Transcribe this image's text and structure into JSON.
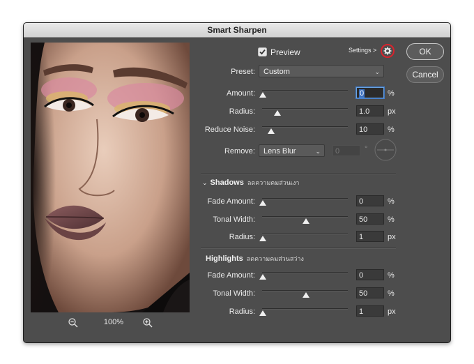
{
  "window": {
    "title": "Smart Sharpen"
  },
  "preview_toggle": {
    "label": "Preview",
    "checked": true
  },
  "settings": {
    "label": "Settings >"
  },
  "buttons": {
    "ok": "OK",
    "cancel": "Cancel"
  },
  "zoom": {
    "level": "100%"
  },
  "main": {
    "preset_label": "Preset:",
    "preset_value": "Custom",
    "amount": {
      "label": "Amount:",
      "value": "0",
      "unit": "%",
      "level": 0.0
    },
    "radius": {
      "label": "Radius:",
      "value": "1.0",
      "unit": "px",
      "level": 0.17
    },
    "reduce_noise": {
      "label": "Reduce Noise:",
      "value": "10",
      "unit": "%",
      "level": 0.1
    },
    "remove": {
      "label": "Remove:",
      "value": "Lens Blur",
      "angle_value": "0",
      "angle_unit": "°"
    }
  },
  "shadows": {
    "heading": "Shadows",
    "subtitle": "ลดความคมส่วนเงา",
    "fade_amount": {
      "label": "Fade Amount:",
      "value": "0",
      "unit": "%",
      "level": 0.0
    },
    "tonal_width": {
      "label": "Tonal Width:",
      "value": "50",
      "unit": "%",
      "level": 0.5
    },
    "radius": {
      "label": "Radius:",
      "value": "1",
      "unit": "px",
      "level": 0.0
    }
  },
  "highlights": {
    "heading": "Highlights",
    "subtitle": "ลดความคมส่วนสว่าง",
    "fade_amount": {
      "label": "Fade Amount:",
      "value": "0",
      "unit": "%",
      "level": 0.0
    },
    "tonal_width": {
      "label": "Tonal Width:",
      "value": "50",
      "unit": "%",
      "level": 0.5
    },
    "radius": {
      "label": "Radius:",
      "value": "1",
      "unit": "px",
      "level": 0.0
    }
  },
  "colors": {
    "accent_ring": "#d9232d",
    "focus": "#3f78c4"
  }
}
